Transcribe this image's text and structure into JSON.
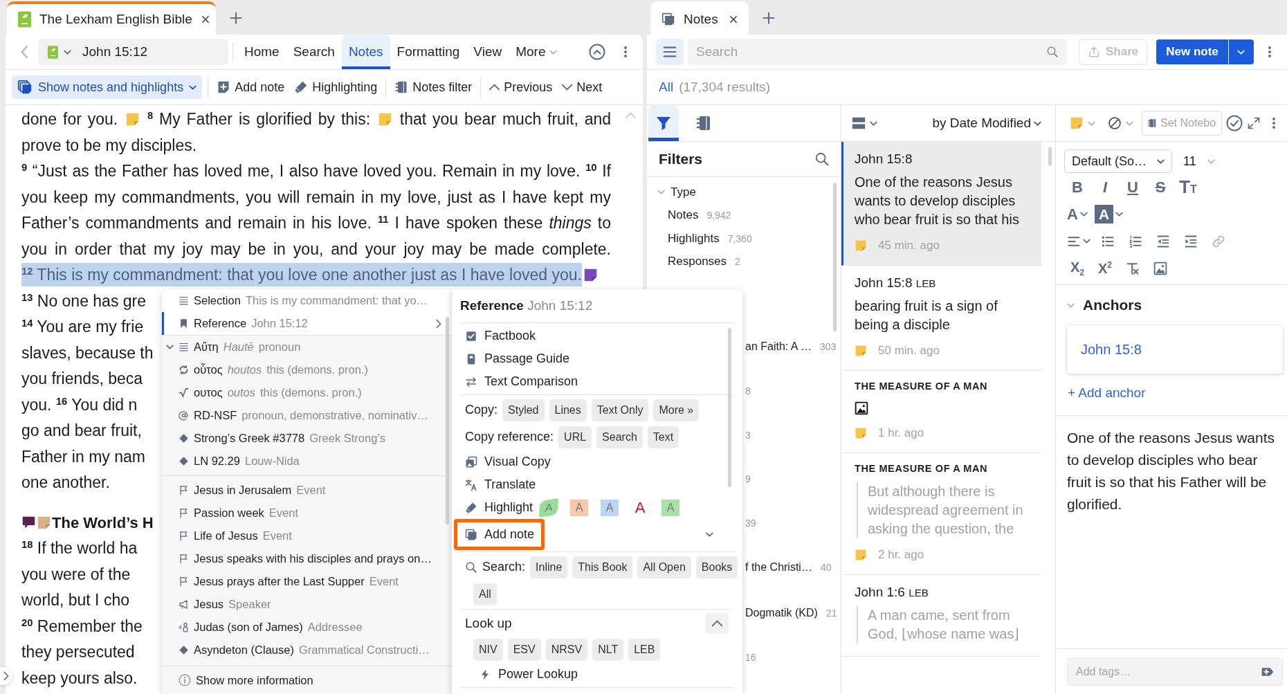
{
  "bible_pane": {
    "tab": {
      "title": "The Lexham English Bible",
      "focused": true
    },
    "reference": "John 15:12",
    "menu_tabs": [
      {
        "label": "Home",
        "selected": false,
        "dropdown": false
      },
      {
        "label": "Search",
        "selected": false,
        "dropdown": false
      },
      {
        "label": "Notes",
        "selected": true,
        "dropdown": false
      },
      {
        "label": "Formatting",
        "selected": false,
        "dropdown": false
      },
      {
        "label": "View",
        "selected": false,
        "dropdown": false
      },
      {
        "label": "More",
        "selected": false,
        "dropdown": true
      }
    ],
    "toolbar": [
      {
        "kind": "dropdown",
        "label": "Show notes and highlights"
      },
      {
        "kind": "button",
        "label": "Add note"
      },
      {
        "kind": "button",
        "label": "Highlighting"
      },
      {
        "kind": "button",
        "label": "Notes filter"
      },
      {
        "kind": "button",
        "label": "Previous"
      },
      {
        "kind": "button",
        "label": "Next"
      }
    ],
    "lines": [
      {
        "kind": "justified",
        "highlighted": false,
        "parts": [
          {
            "kind": "text",
            "text": "done for you. "
          },
          {
            "kind": "note",
            "color": "#f5c54a"
          },
          {
            "kind": "text",
            "text": " $^{8}$ My Father is glorified by this: "
          },
          {
            "kind": "note",
            "color": "#f5c54a"
          },
          {
            "kind": "text",
            "text": " that you bear much fruit, and"
          }
        ]
      },
      {
        "kind": "ragged",
        "highlighted": false,
        "parts": [
          {
            "kind": "text",
            "text": "prove to be my disciples."
          }
        ]
      },
      {
        "kind": "justified",
        "highlighted": false,
        "parts": [
          {
            "kind": "text",
            "text": "$^{9}$ “Just as the Father has loved me, I also have loved you. Remain in my love. $^{10}$ If"
          }
        ]
      },
      {
        "kind": "justified",
        "highlighted": false,
        "parts": [
          {
            "kind": "text",
            "text": "you keep my commandments, you will remain in my love, just as I have kept my"
          }
        ]
      },
      {
        "kind": "justified",
        "highlighted": false,
        "parts": [
          {
            "kind": "text",
            "text": "Father’s commandments and remain in his love. $^{11}$ I have spoken these *things* to"
          }
        ]
      },
      {
        "kind": "justified",
        "highlighted": false,
        "parts": [
          {
            "kind": "text",
            "text": "you in order that my joy may be in you, and your joy may be made complete."
          }
        ]
      },
      {
        "kind": "ragged",
        "highlighted": true,
        "parts": [
          {
            "kind": "text",
            "text": "$^{12}$ This is my commandment: that you love one another just as I have loved you."
          },
          {
            "kind": "note",
            "color": "#7e46b6"
          }
        ]
      },
      {
        "kind": "ragged",
        "highlighted": false,
        "parts": [
          {
            "kind": "text",
            "text": "$^{13}$ No one has gre"
          }
        ]
      },
      {
        "kind": "ragged",
        "highlighted": false,
        "parts": [
          {
            "kind": "text",
            "text": "$^{14}$ You are my frie"
          }
        ]
      },
      {
        "kind": "ragged",
        "highlighted": false,
        "parts": [
          {
            "kind": "text",
            "text": "slaves, because th"
          }
        ]
      },
      {
        "kind": "ragged",
        "highlighted": false,
        "parts": [
          {
            "kind": "text",
            "text": "you friends, beca"
          }
        ]
      },
      {
        "kind": "ragged",
        "highlighted": false,
        "parts": [
          {
            "kind": "text",
            "text": "you. $^{16}$ You did n"
          }
        ]
      },
      {
        "kind": "ragged",
        "highlighted": false,
        "parts": [
          {
            "kind": "text",
            "text": "go and bear fruit,"
          }
        ]
      },
      {
        "kind": "ragged",
        "highlighted": false,
        "parts": [
          {
            "kind": "text",
            "text": "Father in my nam"
          }
        ]
      },
      {
        "kind": "ragged",
        "highlighted": false,
        "parts": [
          {
            "kind": "text",
            "text": "one another."
          }
        ]
      },
      {
        "kind": "heading",
        "highlighted": false,
        "parts": [
          {
            "kind": "comment",
            "color": "#5c1e4c"
          },
          {
            "kind": "note",
            "color": "#ddb08c"
          },
          {
            "kind": "text",
            "text": "The World’s H"
          }
        ]
      },
      {
        "kind": "ragged",
        "highlighted": false,
        "parts": [
          {
            "kind": "text",
            "text": "$^{18}$ If the world ha"
          }
        ]
      },
      {
        "kind": "ragged",
        "highlighted": false,
        "parts": [
          {
            "kind": "text",
            "text": "you were of the"
          }
        ]
      },
      {
        "kind": "ragged",
        "highlighted": false,
        "parts": [
          {
            "kind": "text",
            "text": "world, but I cho"
          }
        ]
      },
      {
        "kind": "ragged",
        "highlighted": false,
        "parts": [
          {
            "kind": "text",
            "text": "$^{20}$ Remember the"
          }
        ]
      },
      {
        "kind": "ragged",
        "highlighted": false,
        "parts": [
          {
            "kind": "text",
            "text": "they persecuted"
          }
        ]
      },
      {
        "kind": "ragged",
        "highlighted": false,
        "parts": [
          {
            "kind": "text",
            "text": "keep yours also."
          }
        ]
      }
    ]
  },
  "context_menu": {
    "selection_rows": [
      {
        "kind": "selection",
        "label": "Selection",
        "detail": "This is my commandment: that yo…",
        "selected": false
      },
      {
        "kind": "reference",
        "label": "Reference",
        "detail": "John 15:12",
        "selected": true
      }
    ],
    "word_group": {
      "expanded": true,
      "items": [
        {
          "kind": "word",
          "label": "Αὔτη",
          "translit": "Hautē",
          "detail": "pronoun"
        },
        {
          "kind": "lemma",
          "label": "οὗτος",
          "translit": "houtos",
          "detail": "this (demons. pron.)"
        },
        {
          "kind": "root",
          "label": "ουτος",
          "translit": "outos",
          "detail": "this (demons. pron.)"
        },
        {
          "kind": "morph",
          "label": "RD-NSF",
          "detail": "pronoun, demonstrative, nominativ…"
        },
        {
          "kind": "entry",
          "label": "Strong’s Greek #3778",
          "detail": "Greek Strong’s"
        },
        {
          "kind": "entry",
          "label": "LN 92.29",
          "detail": "Louw-Nida"
        }
      ]
    },
    "context_rows": [
      {
        "kind": "event",
        "label": "Jesus in Jerusalem",
        "detail": "Event"
      },
      {
        "kind": "event",
        "label": "Passion week",
        "detail": "Event"
      },
      {
        "kind": "event",
        "label": "Life of Jesus",
        "detail": "Event"
      },
      {
        "kind": "event",
        "label": "Jesus speaks with his disciples and prays on…"
      },
      {
        "kind": "event",
        "label": "Jesus prays after the Last Supper",
        "detail": "Event"
      },
      {
        "kind": "speaker",
        "label": "Jesus",
        "detail": "Speaker"
      },
      {
        "kind": "addressee",
        "label": "Judas (son of James)",
        "detail": "Addressee"
      },
      {
        "kind": "entry",
        "label": "Asyndeton (Clause)",
        "detail": "Grammatical Constructi…"
      }
    ],
    "footer": "Show more information"
  },
  "reference_menu": {
    "title": "Reference",
    "detail": "John 15:12",
    "groups": [
      [
        {
          "kind": "action",
          "label": "Factbook",
          "outlined": false,
          "has_options": false
        },
        {
          "kind": "action",
          "label": "Passage Guide",
          "outlined": false,
          "has_options": false
        },
        {
          "kind": "action",
          "label": "Text Comparison",
          "outlined": false,
          "has_options": false
        }
      ],
      [
        {
          "kind": "chips",
          "label": "Copy:",
          "chips": [
            "Styled",
            "Lines",
            "Text Only",
            "More »"
          ]
        },
        {
          "kind": "chips",
          "label": "Copy reference:",
          "chips": [
            "URL",
            "Search",
            "Text"
          ]
        },
        {
          "kind": "action",
          "label": "Visual Copy",
          "outlined": false,
          "has_options": false
        },
        {
          "kind": "action",
          "label": "Translate",
          "outlined": false,
          "has_options": false
        },
        {
          "kind": "highlight",
          "label": "Highlight",
          "swatches": [
            {
              "kind": "marker",
              "label": "A",
              "color": "#98de98"
            },
            {
              "kind": "fill",
              "label": "A",
              "color": "#f8c8a8"
            },
            {
              "kind": "fill",
              "label": "A",
              "color": "#bcd5f5"
            },
            {
              "kind": "text",
              "label": "A",
              "color": "#d1121f"
            },
            {
              "kind": "fill",
              "label": "A",
              "color": "#a6e2a6"
            }
          ]
        },
        {
          "kind": "action",
          "label": "Add note",
          "outlined": true,
          "has_options": true
        }
      ],
      [
        {
          "kind": "search",
          "label": "Search:",
          "chips": [
            "Inline",
            "This Book",
            "All Open",
            "Books"
          ]
        },
        {
          "kind": "chips",
          "chips": [
            "All"
          ]
        }
      ],
      [
        {
          "kind": "section",
          "label": "Look up",
          "expanded": true
        },
        {
          "kind": "chips",
          "chips": [
            "NIV",
            "ESV",
            "NRSV",
            "NLT",
            "LEB"
          ]
        },
        {
          "kind": "action",
          "label": "Power Lookup",
          "outlined": false,
          "has_options": false
        }
      ]
    ]
  },
  "notes_pane": {
    "tab": {
      "title": "Notes",
      "focused": false
    },
    "menu_button": {
      "active": true
    },
    "search": {
      "placeholder": "Search"
    },
    "share": {
      "label": "Share",
      "disabled": true
    },
    "new_note": "New note",
    "scope": "All",
    "results": "(17,304 results)",
    "side_tabs": [
      {
        "selected": true
      },
      {
        "selected": false
      }
    ],
    "filters": {
      "title": "Filters",
      "tree": [
        {
          "label": "Type",
          "expanded": true,
          "children": [
            {
              "label": "Notes",
              "count": "9,942"
            },
            {
              "label": "Highlights",
              "count": "7,360"
            },
            {
              "label": "Responses",
              "count": "2"
            }
          ]
        }
      ],
      "more_rows": [
        {
          "label": "an Faith: A …",
          "count": "303"
        },
        {
          "count": "8"
        },
        {
          "count": "3"
        },
        {
          "count": "9"
        },
        {
          "count": "39"
        },
        {
          "label": "f the Christi…",
          "count": "40"
        },
        {
          "label": "Dogmatik (KD)",
          "count": "21"
        },
        {
          "count": "16"
        }
      ]
    },
    "sort": "by Date Modified",
    "notes": [
      {
        "caps_title": false,
        "title": "John 15:8",
        "kind": "text",
        "body": "One of the reasons Jesus wants to develop disciples who bear fruit is so that his",
        "time": "45 min. ago",
        "selected": true
      },
      {
        "caps_title": false,
        "title": "John 15:8",
        "version": "LEB",
        "kind": "text",
        "body": "bearing fruit is a sign of being a disciple",
        "time": "50 min. ago",
        "selected": false
      },
      {
        "caps_title": true,
        "title": "THE MEASURE OF A MAN",
        "kind": "image",
        "time": "1 hr. ago",
        "selected": false
      },
      {
        "caps_title": true,
        "title": "THE MEASURE OF A MAN",
        "kind": "quote",
        "body": "But although there is widespread agreement in asking the question, the",
        "time": "2 hr. ago",
        "selected": false
      },
      {
        "caps_title": false,
        "title": "John 1:6",
        "version": "LEB",
        "kind": "quote",
        "body": "A man came, sent from God, ⌊whose name was⌋",
        "selected": false
      }
    ],
    "editor": {
      "notebook_placeholder": "Set Notebo",
      "font": "Default (So…",
      "size": "11",
      "format_rows": [
        [
          {
            "kind": "bold",
            "label": "B"
          },
          {
            "kind": "italic",
            "label": "I"
          },
          {
            "kind": "underline",
            "label": "U"
          },
          {
            "kind": "strike",
            "label": "S"
          },
          {
            "kind": "size",
            "label": "TT"
          }
        ],
        [
          {
            "kind": "color",
            "label": "A"
          },
          {
            "kind": "highlight",
            "label": "A"
          }
        ],
        [
          {
            "kind": "align",
            "disabled": false
          },
          {
            "kind": "bullets",
            "disabled": false
          },
          {
            "kind": "numbers",
            "disabled": false
          },
          {
            "kind": "outdent",
            "disabled": false
          },
          {
            "kind": "indent",
            "disabled": false
          },
          {
            "kind": "link",
            "disabled": true
          }
        ],
        [
          {
            "kind": "subscript",
            "label": "X$_{2}$"
          },
          {
            "kind": "superscript",
            "label": "X$^{2}$"
          },
          {
            "kind": "clear"
          },
          {
            "kind": "image"
          }
        ]
      ],
      "anchors": {
        "title": "Anchors",
        "expanded": true,
        "items": [
          "John 15:8"
        ],
        "add": "+ Add anchor"
      },
      "body": "One of the reasons Jesus wants to develop disciples who bear fruit is so that his Father will be glorified.",
      "tags_placeholder": "Add tags…"
    }
  }
}
